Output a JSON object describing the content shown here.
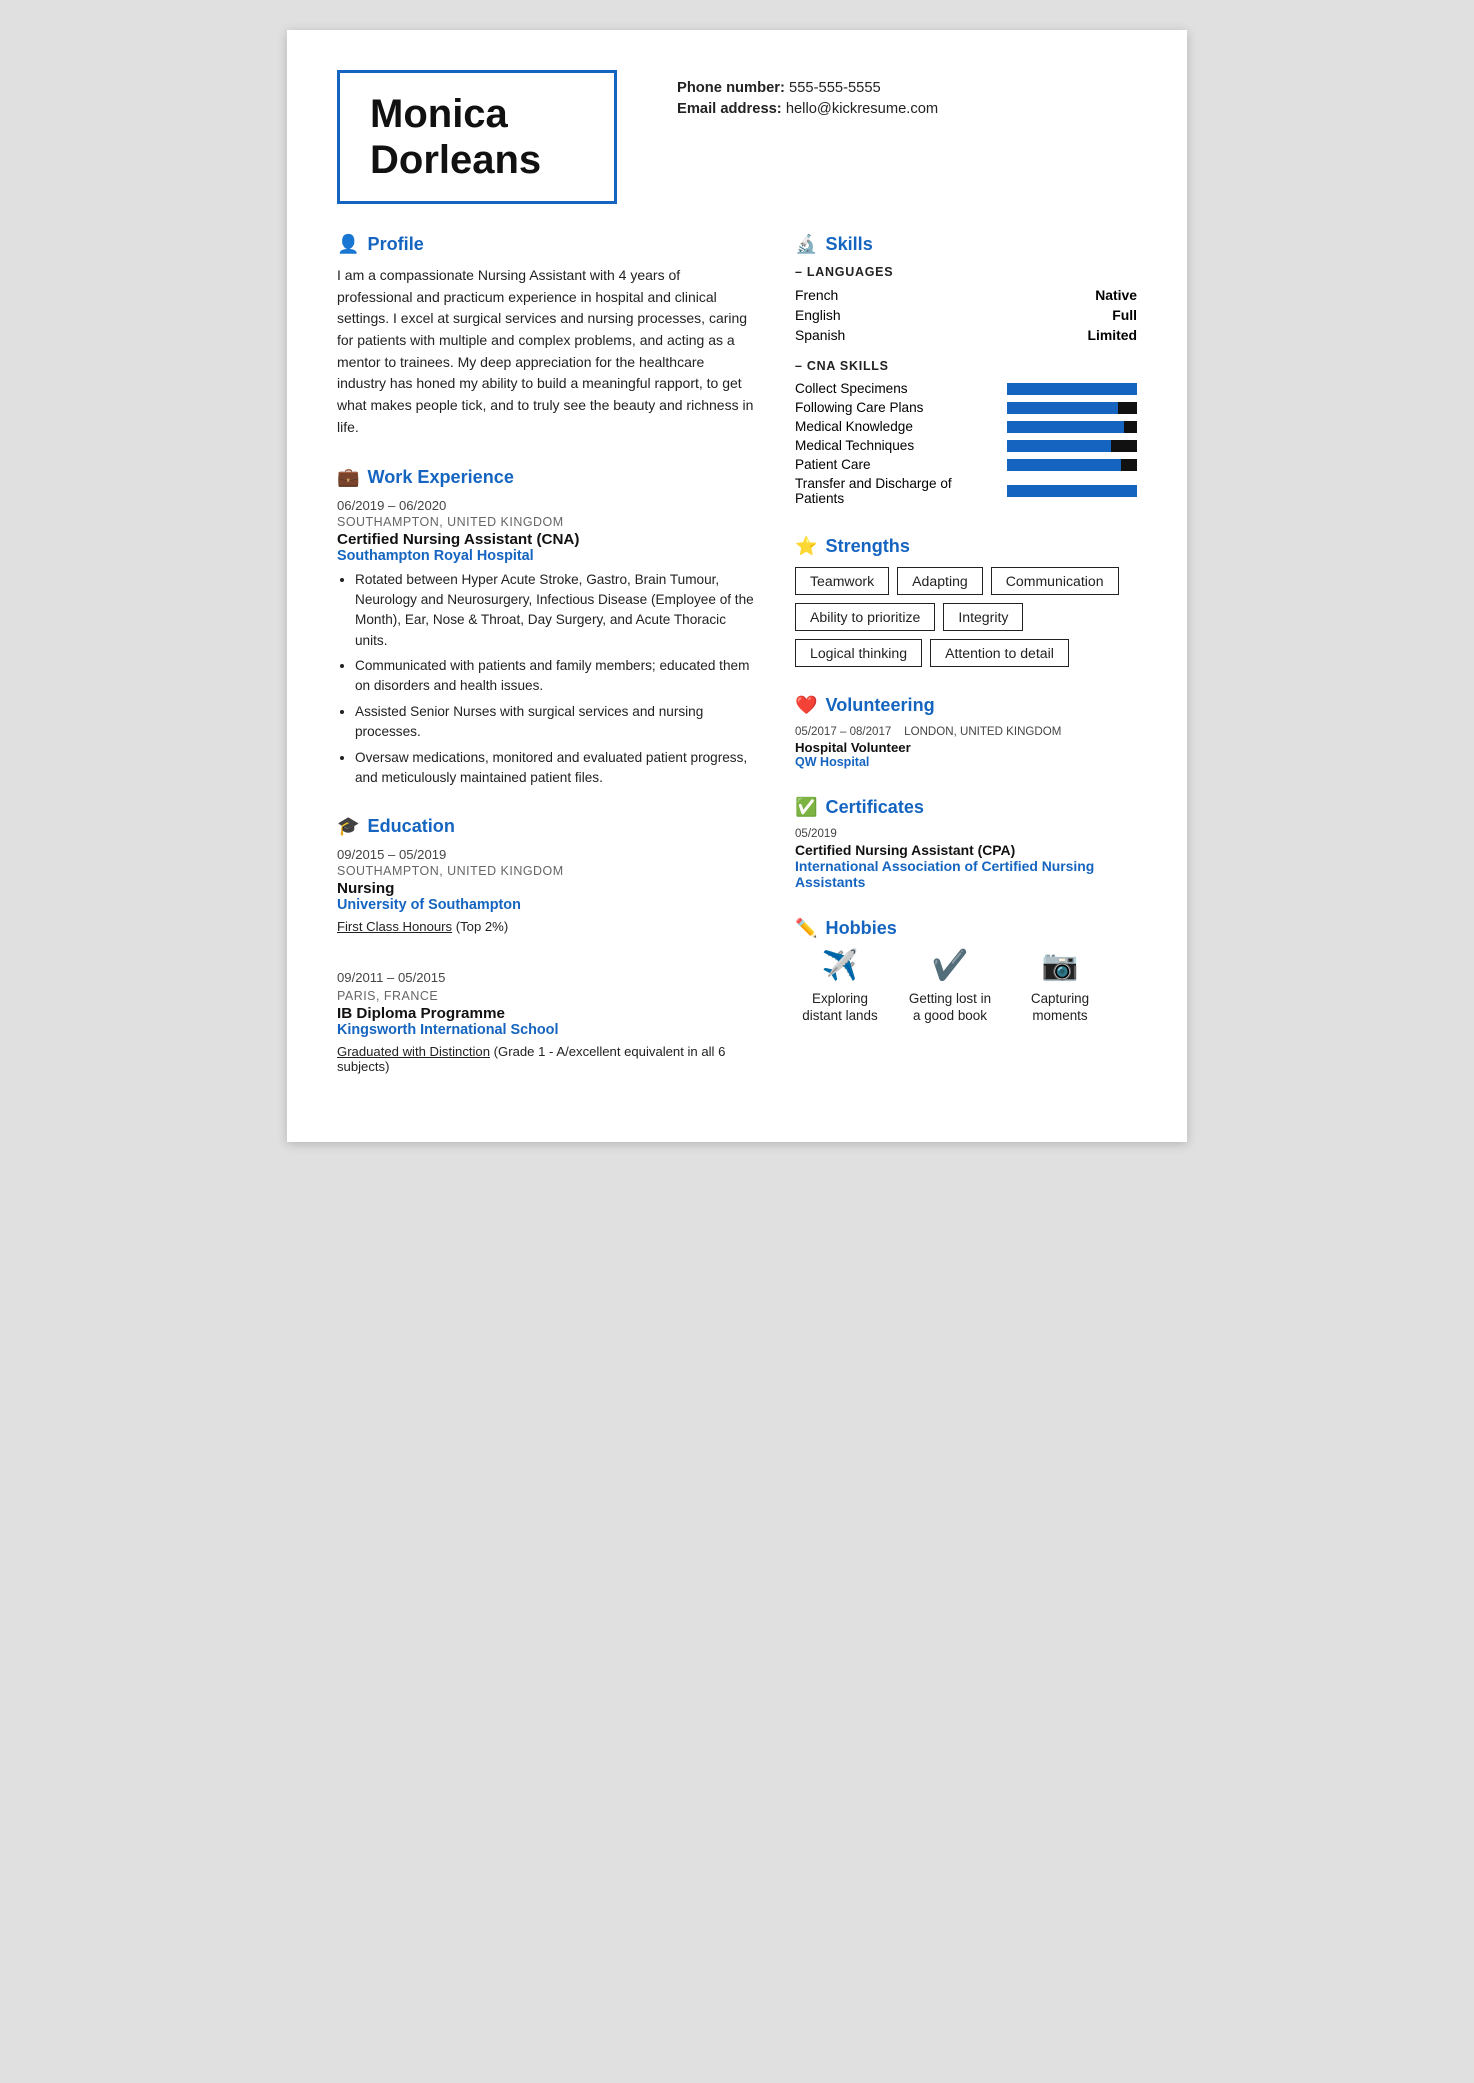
{
  "header": {
    "name_line1": "Monica",
    "name_line2": "Dorleans",
    "phone_label": "Phone number:",
    "phone_value": "555-555-5555",
    "email_label": "Email address:",
    "email_value": "hello@kickresume.com"
  },
  "profile": {
    "section_title": "Profile",
    "icon": "👤",
    "body": "I am a compassionate Nursing Assistant with 4 years of professional and practicum experience in hospital and clinical settings. I excel at surgical services and nursing processes, caring for patients with multiple and complex problems, and acting as a mentor to trainees. My deep appreciation for the healthcare industry has honed my ability to build a meaningful rapport, to get what makes people tick, and to truly see the beauty and richness in life."
  },
  "work_experience": {
    "section_title": "Work Experience",
    "icon": "💼",
    "entries": [
      {
        "date": "06/2019 – 06/2020",
        "location": "SOUTHAMPTON, UNITED KINGDOM",
        "title": "Certified Nursing Assistant (CNA)",
        "company": "Southampton Royal Hospital",
        "bullets": [
          "Rotated between Hyper Acute Stroke,  Gastro, Brain Tumour, Neurology and Neurosurgery, Infectious Disease (Employee of the Month), Ear, Nose & Throat, Day Surgery, and Acute Thoracic units.",
          "Communicated with patients and family members; educated them on disorders and health issues.",
          "Assisted Senior Nurses with surgical services and nursing processes.",
          "Oversaw medications, monitored and evaluated patient progress, and meticulously maintained patient files."
        ]
      }
    ]
  },
  "education": {
    "section_title": "Education",
    "icon": "🎓",
    "entries": [
      {
        "date": "09/2015 – 05/2019",
        "location": "SOUTHAMPTON, UNITED KINGDOM",
        "title": "Nursing",
        "school": "University of Southampton",
        "note_underline": "First Class Honours",
        "note_rest": " (Top 2%)"
      },
      {
        "date": "09/2011 – 05/2015",
        "location": "PARIS, FRANCE",
        "title": "IB Diploma Programme",
        "school": "Kingsworth International School",
        "note_underline": "Graduated with Distinction",
        "note_rest": " (Grade 1 - A/excellent equivalent in all 6 subjects)"
      }
    ]
  },
  "skills": {
    "section_title": "Skills",
    "icon": "🔬",
    "languages_label": "– LANGUAGES",
    "languages": [
      {
        "name": "French",
        "level": "Native"
      },
      {
        "name": "English",
        "level": "Full"
      },
      {
        "name": "Spanish",
        "level": "Limited"
      }
    ],
    "cna_label": "– CNA SKILLS",
    "cna_skills": [
      {
        "name": "Collect Specimens",
        "pct": 100
      },
      {
        "name": "Following Care Plans",
        "pct": 85
      },
      {
        "name": "Medical Knowledge",
        "pct": 90
      },
      {
        "name": "Medical Techniques",
        "pct": 80
      },
      {
        "name": "Patient Care",
        "pct": 88
      },
      {
        "name": "Transfer and Discharge of Patients",
        "pct": 100
      }
    ]
  },
  "strengths": {
    "section_title": "Strengths",
    "icon": "⭐",
    "tags": [
      "Teamwork",
      "Adapting",
      "Communication",
      "Ability to prioritize",
      "Integrity",
      "Logical thinking",
      "Attention to detail"
    ]
  },
  "volunteering": {
    "section_title": "Volunteering",
    "icon": "❤️",
    "entries": [
      {
        "date": "05/2017 – 08/2017",
        "location": "LONDON, UNITED KINGDOM",
        "title": "Hospital Volunteer",
        "org": "QW Hospital"
      }
    ]
  },
  "certificates": {
    "section_title": "Certificates",
    "icon": "✅",
    "entries": [
      {
        "date": "05/2019",
        "title": "Certified Nursing Assistant (CPA)",
        "org": "International Association of Certified Nursing Assistants"
      }
    ]
  },
  "hobbies": {
    "section_title": "Hobbies",
    "icon": "✏️",
    "items": [
      {
        "label": "Exploring distant lands",
        "icon": "✈️"
      },
      {
        "label": "Getting lost in a good book",
        "icon": "✔️"
      },
      {
        "label": "Capturing moments",
        "icon": "📷"
      }
    ]
  }
}
